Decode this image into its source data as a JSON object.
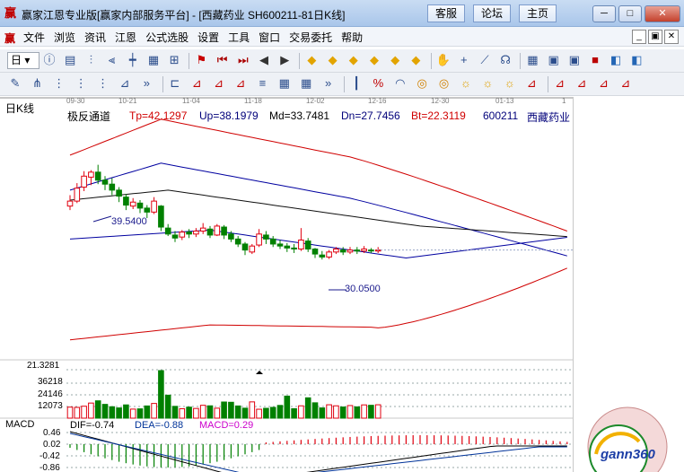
{
  "window": {
    "title": "赢家江恩专业版[赢家内部服务平台] - [西藏药业  SH600211-81日K线]",
    "logo_glyph": "赢",
    "buttons": [
      "客服",
      "论坛",
      "主页"
    ],
    "controls": {
      "minimize": "─",
      "restore": "□",
      "close": "✕"
    }
  },
  "menubar": {
    "items": [
      "文件",
      "浏览",
      "资讯",
      "江恩",
      "公式选股",
      "设置",
      "工具",
      "窗口",
      "交易委托",
      "帮助"
    ],
    "mdi_controls": [
      "_",
      "▣",
      "✕"
    ]
  },
  "toolbar1": {
    "period": "日",
    "icons": [
      "info-icon",
      "chart-type-icon",
      "kline-icon",
      "hollow-kline-icon",
      "candlestick-icon",
      "bar-icon",
      "gann-icon",
      "flag-icon",
      "first-icon",
      "prev-page-icon",
      "prev-icon",
      "next-icon",
      "diamond-icon",
      "diamond-icon",
      "diamond-icon",
      "diamond-icon",
      "diamond-icon",
      "diamond-icon",
      "hand-icon",
      "crosshair-icon",
      "zigzag-icon",
      "shell-icon",
      "grid-icon",
      "window-icon",
      "window-icon",
      "save-icon",
      "palette-icon",
      "palette-icon"
    ]
  },
  "toolbar2": {
    "icons": [
      "pen-icon",
      "fork-icon",
      "dots-icon",
      "dots-icon",
      "dots-icon",
      "measure-icon",
      "more-icon",
      "bracket-icon",
      "fan-icon",
      "fan-icon",
      "fan-icon",
      "lines-icon",
      "grid-icon",
      "grid-icon",
      "more-icon",
      "ruler-icon",
      "percent-icon",
      "arc-icon",
      "circle-icon",
      "circle-icon",
      "sun-icon",
      "sun-icon",
      "sun-icon",
      "fan-icon",
      "fan-icon",
      "fan-icon",
      "fan-icon",
      "fan-icon"
    ]
  },
  "chart": {
    "period_label": "日K线",
    "date_ticks": [
      "09-30",
      "10-21",
      "11-04",
      "11-18",
      "12-02",
      "12-16",
      "12-30",
      "01-13",
      "1"
    ],
    "indicator_header": {
      "name": "极反通道",
      "tp": "Tp=42.1297",
      "up": "Up=38.1979",
      "md": "Md=33.7481",
      "dn": "Dn=27.7456",
      "bt": "Bt=22.3119",
      "code": "600211",
      "stock": "西藏药业"
    },
    "annotations": {
      "high": "39.5400",
      "low": "30.0500"
    },
    "volume_axis": [
      "21.3281",
      "36218",
      "24146",
      "12073"
    ],
    "macd": {
      "name": "MACD",
      "dif": "DIF=-0.74",
      "dea": "DEA=-0.88",
      "macd": "MACD=0.29",
      "axis": [
        "0.46",
        "0.02",
        "-0.42",
        "-0.86"
      ]
    },
    "colors": {
      "up": "#e0000f",
      "down": "#008000",
      "outer": "#d00000",
      "middle": "#0000a0",
      "mid": "#101010"
    },
    "watermark": "gann360"
  },
  "chart_data": {
    "type": "candlestick",
    "candles": [
      [
        35.4,
        35.9,
        35.0,
        36.5
      ],
      [
        35.9,
        37.2,
        35.7,
        37.7
      ],
      [
        37.3,
        38.4,
        36.9,
        38.9
      ],
      [
        38.3,
        38.8,
        37.5,
        39.0
      ],
      [
        38.8,
        38.0,
        37.6,
        39.54
      ],
      [
        38.0,
        37.6,
        37.0,
        38.4
      ],
      [
        37.6,
        37.0,
        36.5,
        38.2
      ],
      [
        37.0,
        36.4,
        35.8,
        37.3
      ],
      [
        36.3,
        35.5,
        35.0,
        36.6
      ],
      [
        35.4,
        35.8,
        35.1,
        36.2
      ],
      [
        35.7,
        35.2,
        34.7,
        36.0
      ],
      [
        35.2,
        34.8,
        34.2,
        35.5
      ],
      [
        34.8,
        35.9,
        34.6,
        36.3
      ],
      [
        35.4,
        33.3,
        32.9,
        35.5
      ],
      [
        33.2,
        32.6,
        32.4,
        33.6
      ],
      [
        32.5,
        32.2,
        31.8,
        32.9
      ],
      [
        32.3,
        32.8,
        32.0,
        33.0
      ],
      [
        32.8,
        32.6,
        32.2,
        33.1
      ],
      [
        32.6,
        32.9,
        32.3,
        33.2
      ],
      [
        32.9,
        33.2,
        32.6,
        33.7
      ],
      [
        33.1,
        32.5,
        32.2,
        33.4
      ],
      [
        32.5,
        33.4,
        32.4,
        33.6
      ],
      [
        33.3,
        32.5,
        32.1,
        33.5
      ],
      [
        32.6,
        32.1,
        31.8,
        32.9
      ],
      [
        32.1,
        31.6,
        31.3,
        32.4
      ],
      [
        31.6,
        31.0,
        30.5,
        31.8
      ],
      [
        30.8,
        31.4,
        30.6,
        31.6
      ],
      [
        31.5,
        32.6,
        31.3,
        33.1
      ],
      [
        32.5,
        32.1,
        31.6,
        32.9
      ],
      [
        32.1,
        31.6,
        31.3,
        32.4
      ],
      [
        31.6,
        31.4,
        31.1,
        32.0
      ],
      [
        31.4,
        31.2,
        30.8,
        31.7
      ],
      [
        31.2,
        31.1,
        30.7,
        31.6
      ],
      [
        31.1,
        32.0,
        30.9,
        33.2
      ],
      [
        31.9,
        31.1,
        30.8,
        32.2
      ],
      [
        31.1,
        30.6,
        30.2,
        31.2
      ],
      [
        30.5,
        30.3,
        30.05,
        30.9
      ],
      [
        30.3,
        30.8,
        30.1,
        31.0
      ],
      [
        30.8,
        31.1,
        30.6,
        31.3
      ],
      [
        31.0,
        30.8,
        30.5,
        31.3
      ],
      [
        30.8,
        31.0,
        30.6,
        31.3
      ],
      [
        31.0,
        30.9,
        30.6,
        31.3
      ],
      [
        30.9,
        31.1,
        30.7,
        31.4
      ],
      [
        31.0,
        30.9,
        30.7,
        31.2
      ],
      [
        30.9,
        31.0,
        30.7,
        31.3
      ]
    ],
    "volume": [
      8400,
      8200,
      9100,
      11500,
      13200,
      10500,
      8700,
      7800,
      10100,
      6900,
      7100,
      9300,
      11200,
      36218,
      17500,
      9000,
      7200,
      8400,
      7400,
      9800,
      9400,
      7600,
      12300,
      12100,
      9300,
      7600,
      12400,
      6800,
      7500,
      8200,
      9700,
      16800,
      7200,
      9400,
      15500,
      11700,
      7800,
      10200,
      9400,
      8500,
      9600,
      8600,
      10100,
      9800,
      10200
    ]
  }
}
